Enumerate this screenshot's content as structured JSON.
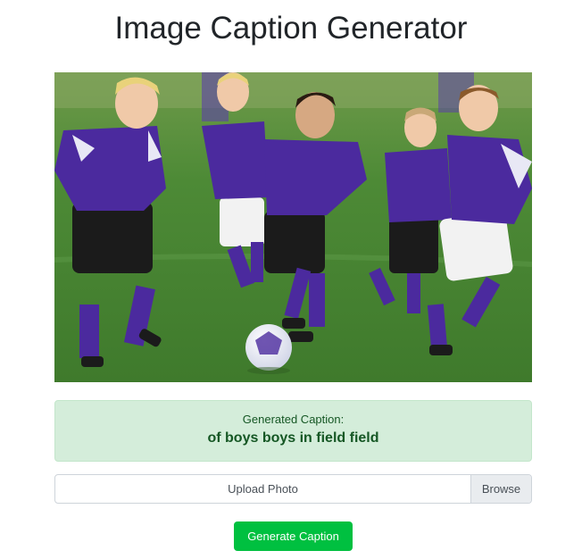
{
  "header": {
    "title": "Image Caption Generator"
  },
  "photo": {
    "alt": "Children playing soccer on a grass field",
    "colors": {
      "grass": "#4f8a3a",
      "jersey": "#4b2a9e",
      "shorts_dark": "#1b1b1b",
      "shorts_light": "#f2f2f2"
    }
  },
  "result": {
    "label": "Generated Caption:",
    "caption": "of boys boys in field field",
    "colors": {
      "background": "#d4edda",
      "text": "#155724"
    }
  },
  "upload": {
    "label": "Upload Photo",
    "browse_label": "Browse"
  },
  "actions": {
    "generate_label": "Generate Caption",
    "color": "#00c040"
  }
}
